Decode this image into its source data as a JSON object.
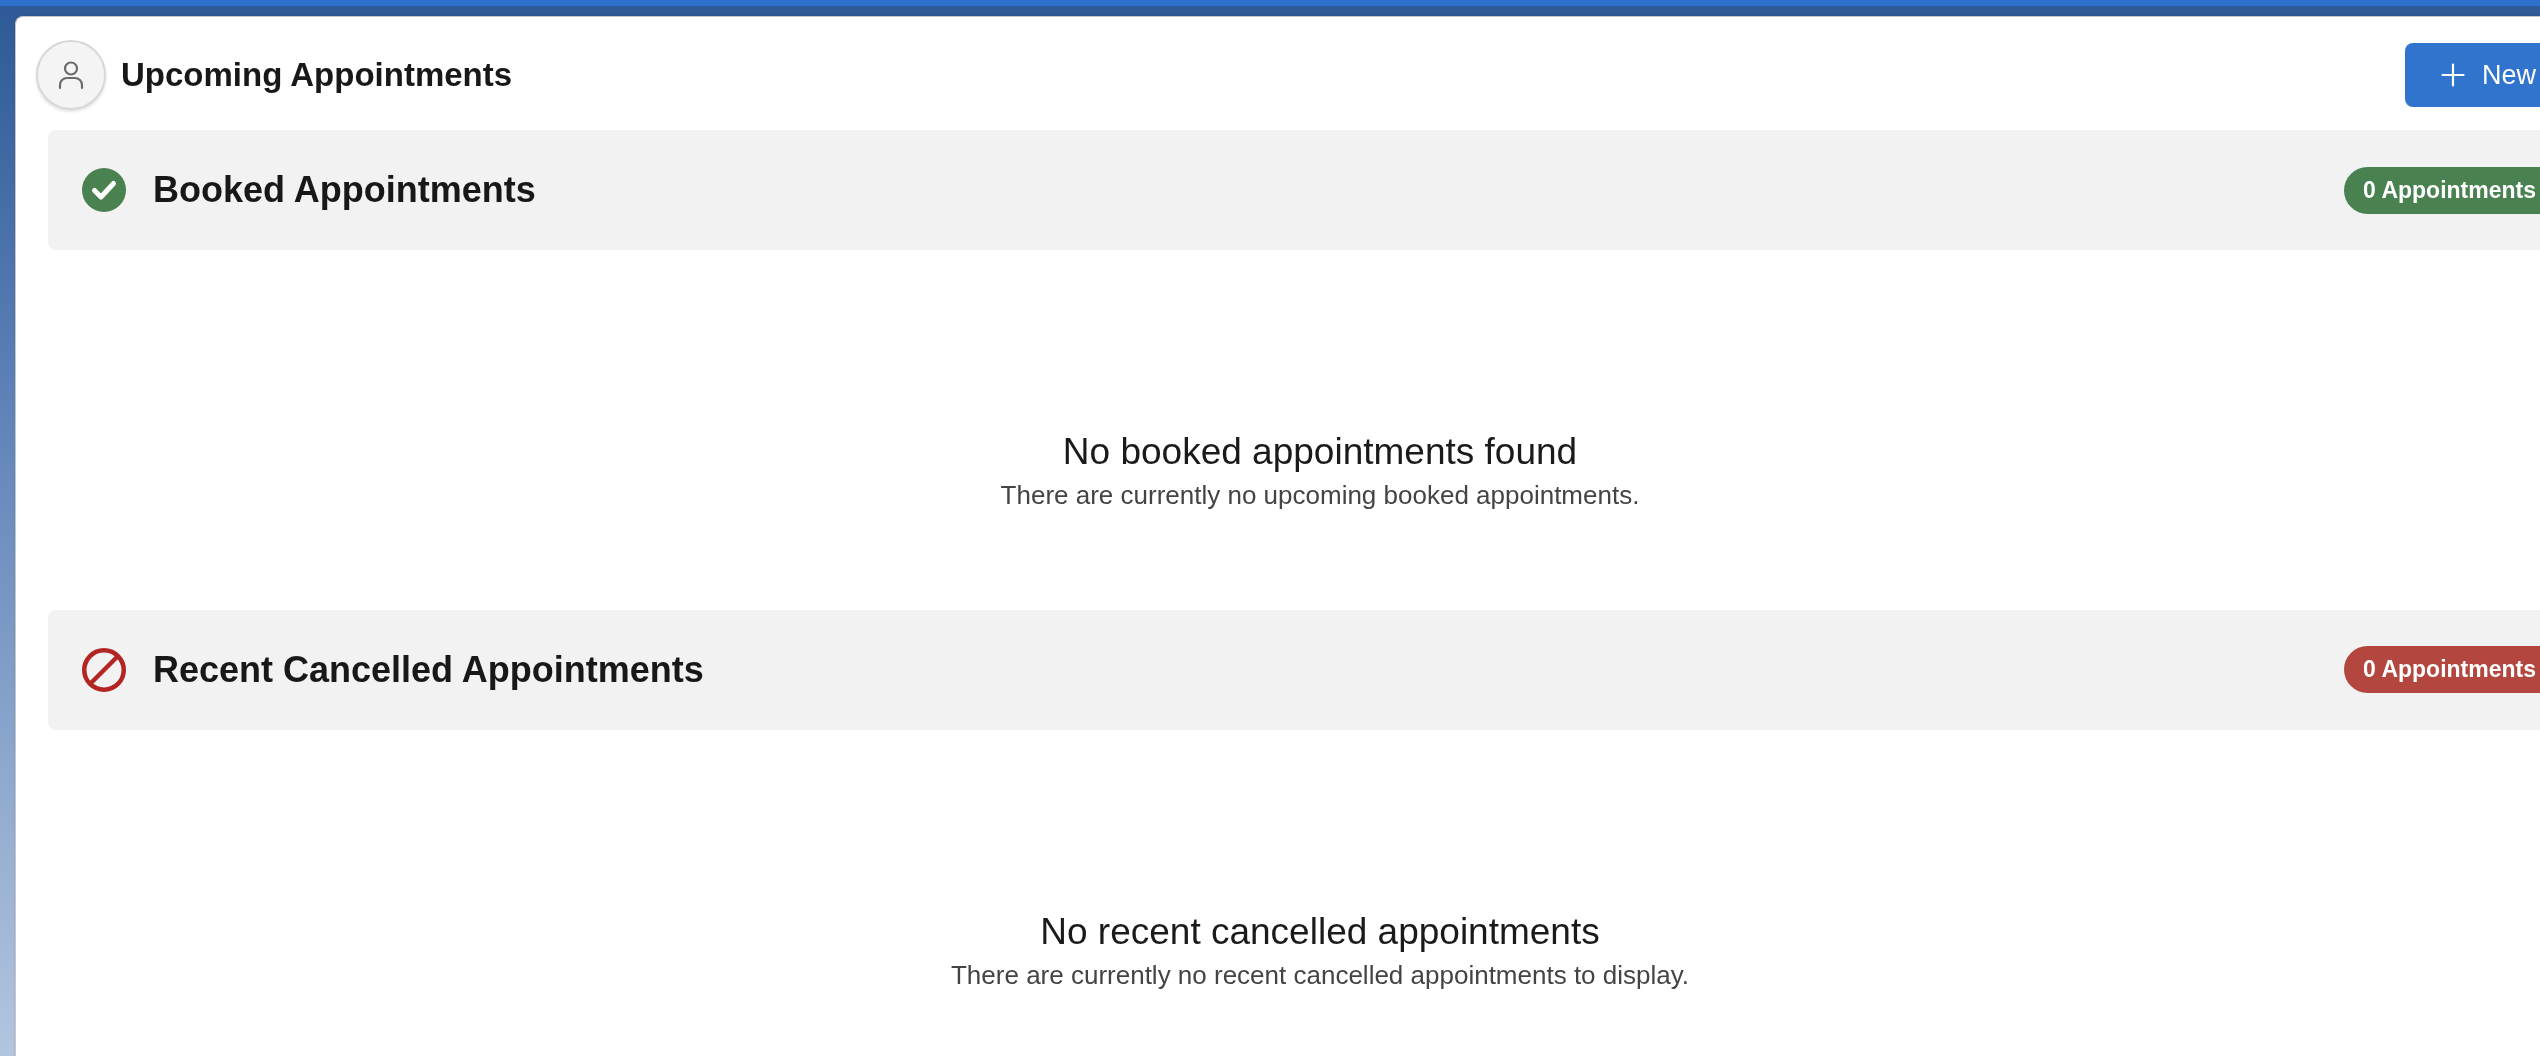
{
  "header": {
    "title": "Upcoming Appointments",
    "new_button": {
      "label": "New"
    }
  },
  "sections": [
    {
      "kind": "booked",
      "title": "Booked Appointments",
      "badge": "0 Appointments",
      "color": "#4a8151",
      "empty_title": "No booked appointments found",
      "empty_message": "There are currently no upcoming booked appointments."
    },
    {
      "kind": "cancelled",
      "title": "Recent Cancelled Appointments",
      "badge": "0 Appointments",
      "color": "#b3463e",
      "empty_title": "No recent cancelled appointments",
      "empty_message": "There are currently no recent cancelled appointments to display."
    }
  ]
}
